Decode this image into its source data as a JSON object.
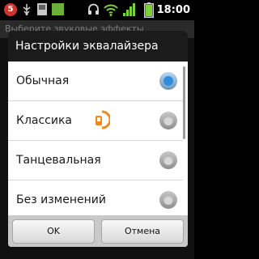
{
  "status_bar": {
    "notification_count": "5",
    "time": "18:00",
    "icons": [
      "notification-count-icon",
      "usb-icon",
      "sd-card-icon",
      "app-notification-icon",
      "headphones-icon",
      "wifi-icon",
      "signal-icon",
      "battery-icon"
    ]
  },
  "background": {
    "title": "Выберите звуковые эффекты"
  },
  "dialog": {
    "title": "Настройки эквалайзера",
    "options": [
      {
        "label": "Обычная",
        "selected": true
      },
      {
        "label": "Классика",
        "selected": false
      },
      {
        "label": "Танцевальная",
        "selected": false
      },
      {
        "label": "Без изменений",
        "selected": false
      }
    ],
    "ok_label": "OK",
    "cancel_label": "Отмена"
  },
  "colors": {
    "accent": "#2f8edb",
    "app_icon": "#f08a1c",
    "notification_badge": "#d0342c"
  }
}
